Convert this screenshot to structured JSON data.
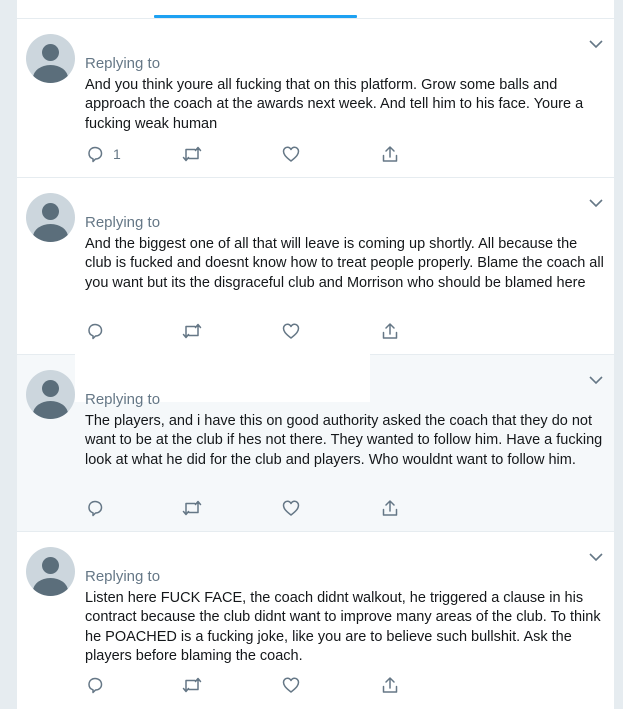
{
  "replying_label": "Replying to",
  "tweets": [
    {
      "text": "And you think youre all fucking that on this platform. Grow some balls and approach the coach at the awards next week. And tell him to his face. Youre a fucking weak human",
      "reply_count": "1"
    },
    {
      "text": "And the biggest one of all that will leave is coming up shortly. All because the club is fucked and doesnt know how to treat people properly. Blame the coach all you want but its the disgraceful club and Morrison who should be blamed here",
      "reply_count": ""
    },
    {
      "text": "The players, and i have this on good authority asked the coach that they do not want to be at the club if hes not there. They wanted to follow him. Have a fucking look at what he did for the club and players. Who wouldnt want to follow him.",
      "reply_count": ""
    },
    {
      "text": "Listen here FUCK FACE, the coach didnt walkout, he triggered a clause in his contract because the club didnt want to improve many areas of the club. To think he POACHED is a fucking joke, like you are to believe such bullshit. Ask the players before blaming the coach.",
      "reply_count": ""
    }
  ],
  "icons": {
    "reply": "reply-icon",
    "retweet": "retweet-icon",
    "like": "like-icon",
    "share": "share-icon",
    "more": "chevron-down-icon"
  },
  "colors": {
    "icon": "#657786",
    "text": "#14171a",
    "secondary": "#657786",
    "accent": "#1da1f2",
    "highlight_bg": "#f5f8fa"
  }
}
